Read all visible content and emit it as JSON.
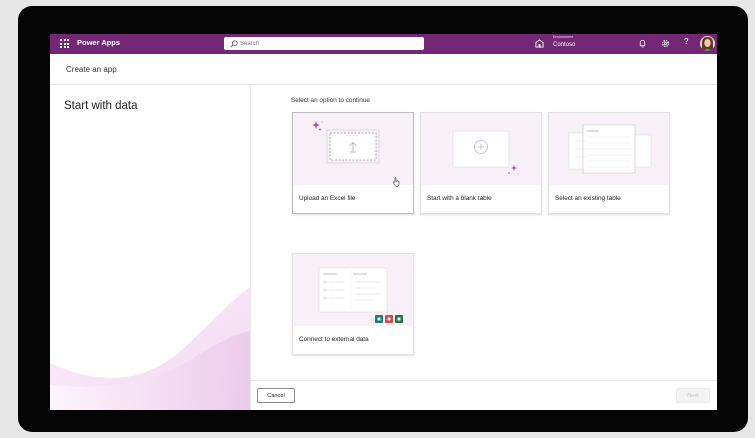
{
  "app": {
    "name": "Power Apps"
  },
  "search": {
    "placeholder": "Search"
  },
  "environment": {
    "label": "Environment",
    "name": "Contoso"
  },
  "help": {
    "glyph": "?"
  },
  "page": {
    "title": "Create an app"
  },
  "left_panel": {
    "heading": "Start with data"
  },
  "main": {
    "prompt": "Select an option to continue",
    "options": [
      {
        "label": "Upload an Excel file"
      },
      {
        "label": "Start with a blank table"
      },
      {
        "label": "Select an existing table"
      },
      {
        "label": "Connect to external data"
      }
    ]
  },
  "footer": {
    "cancel_label": "Cancel",
    "next_label": "Next"
  },
  "colors": {
    "brand": "#742774",
    "art_background": "#f7f0f7",
    "accent_pink": "#c03fc0"
  },
  "icons": [
    "waffle-icon",
    "search-icon",
    "environment-icon",
    "bell-icon",
    "gear-icon",
    "help-icon",
    "avatar",
    "hand-cursor-icon"
  ]
}
